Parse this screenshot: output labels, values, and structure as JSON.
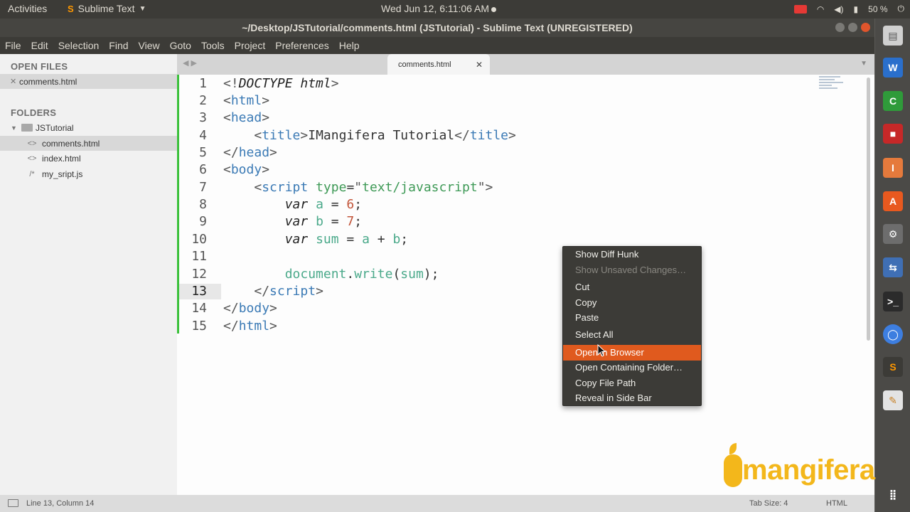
{
  "panel": {
    "activities": "Activities",
    "app_name": "Sublime Text",
    "clock": "Wed Jun 12,  6:11:06 AM",
    "battery": "50 %"
  },
  "window": {
    "title": "~/Desktop/JSTutorial/comments.html (JSTutorial) - Sublime Text (UNREGISTERED)"
  },
  "menubar": [
    "File",
    "Edit",
    "Selection",
    "Find",
    "View",
    "Goto",
    "Tools",
    "Project",
    "Preferences",
    "Help"
  ],
  "sidebar": {
    "open_files_header": "OPEN FILES",
    "open_files": [
      {
        "name": "comments.html"
      }
    ],
    "folders_header": "FOLDERS",
    "folder": "JSTutorial",
    "files": [
      {
        "name": "comments.html",
        "icon": "<>"
      },
      {
        "name": "index.html",
        "icon": "<>"
      },
      {
        "name": "my_sript.js",
        "icon": "/*"
      }
    ]
  },
  "tab": {
    "label": "comments.html"
  },
  "editor": {
    "line_numbers": [
      "1",
      "2",
      "3",
      "4",
      "5",
      "6",
      "7",
      "8",
      "9",
      "10",
      "11",
      "12",
      "13",
      "14",
      "15"
    ],
    "current_line": 13
  },
  "context_menu": {
    "items": [
      {
        "label": "Show Diff Hunk",
        "state": "normal"
      },
      {
        "label": "Show Unsaved Changes…",
        "state": "disabled"
      },
      {
        "label": "Cut",
        "state": "normal"
      },
      {
        "label": "Copy",
        "state": "normal"
      },
      {
        "label": "Paste",
        "state": "normal"
      },
      {
        "label": "Select All",
        "state": "normal"
      },
      {
        "label": "Open in Browser",
        "state": "highlighted"
      },
      {
        "label": "Open Containing Folder…",
        "state": "normal"
      },
      {
        "label": "Copy File Path",
        "state": "normal"
      },
      {
        "label": "Reveal in Side Bar",
        "state": "normal"
      }
    ]
  },
  "status": {
    "position": "Line 13, Column 14",
    "tab_size": "Tab Size: 4",
    "syntax": "HTML"
  },
  "watermark": {
    "text": "mangifera"
  },
  "colors": {
    "accent": "#e05a1e",
    "logo": "#f3b71b",
    "diff_gutter": "#3cc13c"
  }
}
